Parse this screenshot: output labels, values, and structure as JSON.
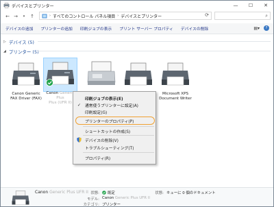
{
  "window": {
    "title": "デバイスとプリンター",
    "minimize": "—",
    "maximize": "☐",
    "close": "✕"
  },
  "address": {
    "crumbs": [
      "すべてのコントロール パネル項目",
      "デバイスとプリンター"
    ],
    "separator": "›"
  },
  "commands": [
    "デバイスの追加",
    "プリンターの追加",
    "印刷ジョブの表示",
    "プリント サーバー プロパティ",
    "デバイスの削除"
  ],
  "groups": {
    "devices": "デバイス (5)",
    "printers": "プリンター (5)"
  },
  "printers": [
    {
      "line1": "Canon Generic",
      "line2": "FAX Driver (FAX)"
    },
    {
      "line1": "Canon",
      "line1_blur": "Generic Plus",
      "line2": "",
      "line2_blur": "Plus (UFR II)"
    },
    {
      "line1": "",
      "line2": ""
    },
    {
      "line1": "",
      "line2": ""
    },
    {
      "line1": "Microsoft XPS",
      "line2": "Document Writer"
    }
  ],
  "context_menu": [
    {
      "label": "印刷ジョブの表示(E)",
      "bold": true
    },
    {
      "label": "通常使うプリンターに設定(A)",
      "check": "✓"
    },
    {
      "label": "印刷設定(G)"
    },
    {
      "label": "プリンターのプロパティ(P)",
      "highlighted": true
    },
    {
      "label": "ショートカットの作成(S)"
    },
    {
      "label": "デバイスの削除(V)",
      "shield": true
    },
    {
      "label": "トラブルシューティング(T)"
    },
    {
      "label": "プロパティ(R)"
    }
  ],
  "status": {
    "name": "Canon",
    "name_blur": "Generic Plus UFR II",
    "state_label": "状態:",
    "state_value": "既定",
    "status_label": "状態:",
    "status_value": "キューに 0 個のドキュメント",
    "model_label": "モデル:",
    "model_value": "Canon",
    "model_blur": "Generic Plus UFR II",
    "category_label": "カテゴリ:",
    "category_value": "プリンター"
  },
  "colors": {
    "accent": "#1e4f9c",
    "highlight": "#f0a030",
    "default_check": "#1fa24a"
  }
}
